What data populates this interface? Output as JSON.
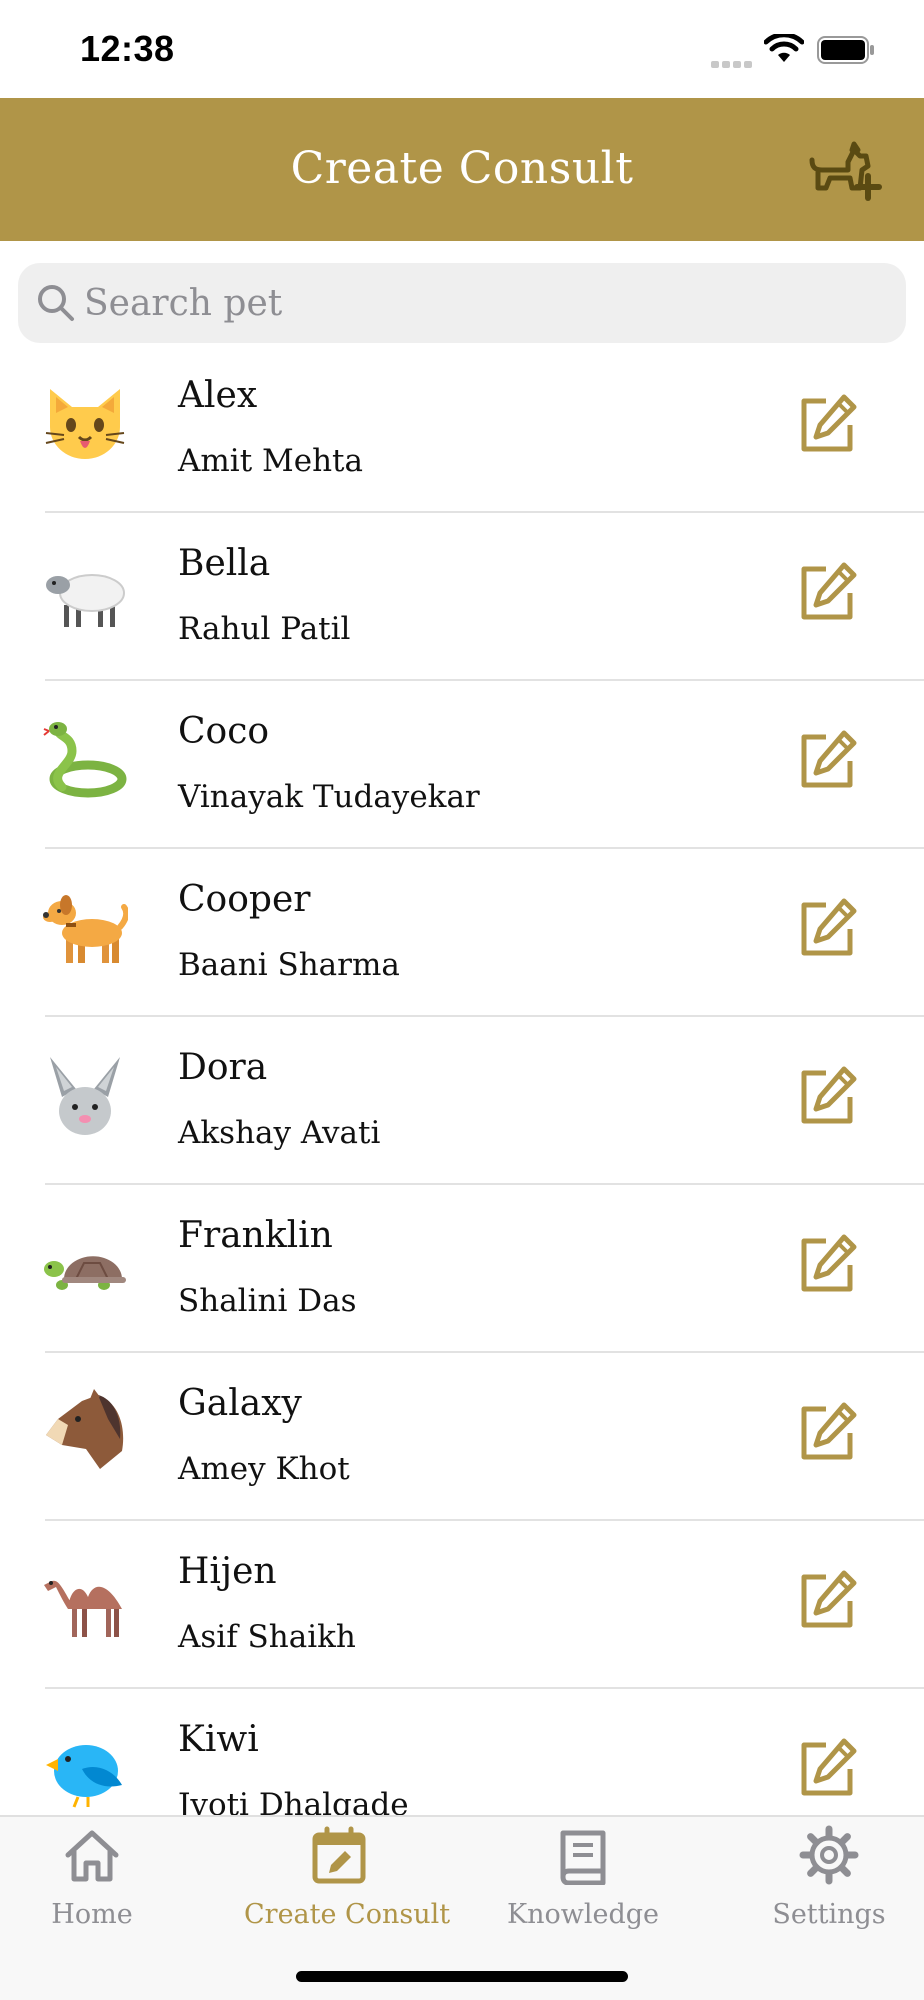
{
  "status_bar": {
    "time": "12:38"
  },
  "header": {
    "title": "Create Consult",
    "add_pet_icon": "pet-plus-icon"
  },
  "search": {
    "placeholder": "Search pet",
    "value": ""
  },
  "pets": [
    {
      "name": "Alex",
      "owner": "Amit  Mehta",
      "icon": "cat-face-icon"
    },
    {
      "name": "Bella",
      "owner": "Rahul Patil",
      "icon": "sheep-icon"
    },
    {
      "name": "Coco",
      "owner": "Vinayak Tudayekar",
      "icon": "snake-icon"
    },
    {
      "name": "Cooper",
      "owner": "Baani Sharma",
      "icon": "dog-icon"
    },
    {
      "name": "Dora",
      "owner": "Akshay Avati",
      "icon": "rabbit-face-icon"
    },
    {
      "name": "Franklin",
      "owner": "Shalini Das",
      "icon": "turtle-icon"
    },
    {
      "name": "Galaxy",
      "owner": "Amey Khot",
      "icon": "horse-face-icon"
    },
    {
      "name": "Hijen",
      "owner": "Asif Shaikh",
      "icon": "camel-icon"
    },
    {
      "name": "Kiwi",
      "owner": "Jyoti Dhalgade",
      "icon": "bird-icon"
    }
  ],
  "tabs": [
    {
      "label": "Home",
      "icon": "home-icon",
      "active": false
    },
    {
      "label": "Create Consult",
      "icon": "calendar-edit-icon",
      "active": true
    },
    {
      "label": "Knowledge",
      "icon": "book-icon",
      "active": false
    },
    {
      "label": "Settings",
      "icon": "gear-icon",
      "active": false
    }
  ],
  "colors": {
    "accent": "#b09548",
    "inactive": "#8e8e93",
    "search_bg": "#efefef"
  }
}
